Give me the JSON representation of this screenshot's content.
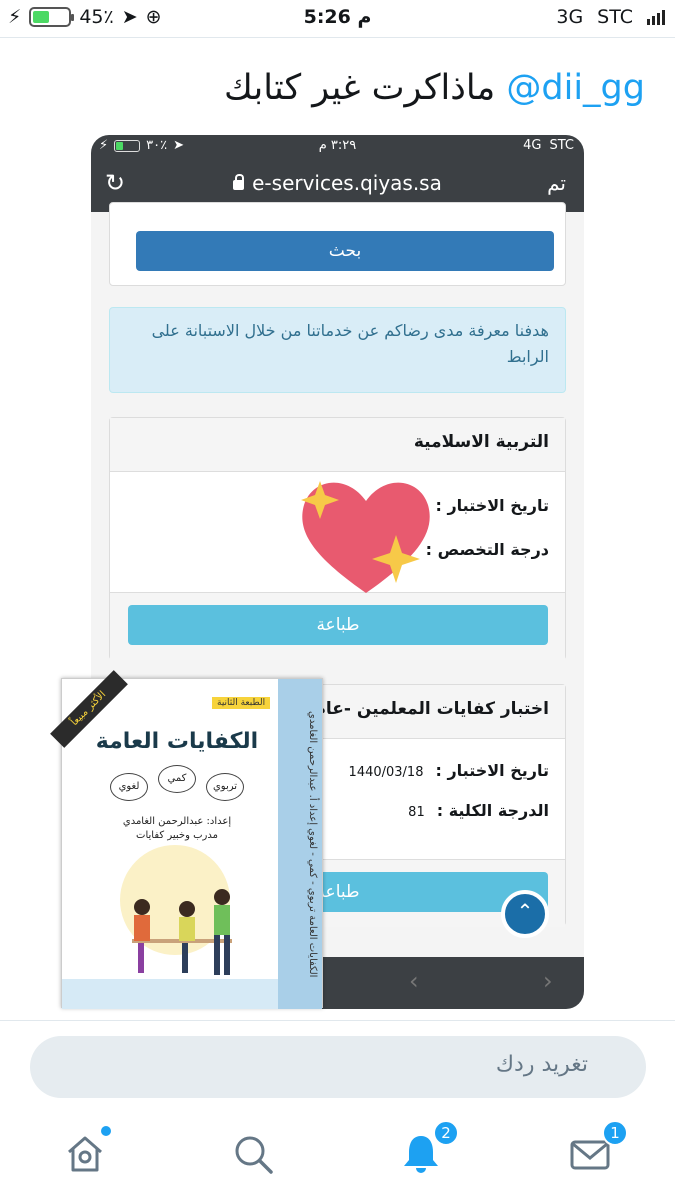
{
  "status_bar": {
    "battery": "45٪",
    "time": "5:26 م",
    "network": "3G",
    "carrier": "STC",
    "battery_level": 0.45
  },
  "tweet": {
    "mention": "@dii_gg",
    "text": "ماذاكرت غير كتابك"
  },
  "embedded": {
    "status": {
      "battery": "٣٠٪",
      "time": "٣:٢٩ م",
      "network": "4G",
      "carrier": "STC"
    },
    "url": "e-services.qiyas.sa",
    "done": "تم",
    "search_button": "بحث",
    "survey_note": "هدفنا معرفة مدى رضاكم عن خدماتنا من خلال الاستبانة على الرابط",
    "card1": {
      "title": "التربية الاسلامية",
      "date_label": "تاريخ الاختبار :",
      "spec_label": "درجة التخصص :",
      "print": "طباعة"
    },
    "card2": {
      "title": "اختبار كفايات المعلمين -عام",
      "date_label": "تاريخ الاختبار :",
      "date_value": "1440/03/18",
      "score_label": "الدرجة الكلية :",
      "score_value": "81",
      "print": "طباعة"
    },
    "scroll_up": "⌃",
    "nav_prev": "‹",
    "nav_next": "›"
  },
  "book": {
    "edition": "الطبعة الثانية",
    "ribbon": "الأكثر مبيعاً",
    "title": "الكفايات العامة",
    "tags": [
      "تربوي",
      "كمي",
      "لغوي"
    ],
    "author_line1": "إعداد: عبدالرحمن الغامدي",
    "author_line2": "مدرب وخبير كفايات",
    "spine": "الكفايات العامة   تربوي - كمي - لغوي   إعداد أ. عبدالرحمن الغامدي"
  },
  "reply_placeholder": "تغريد ردك",
  "tabs": [
    {
      "name": "home",
      "badge": ""
    },
    {
      "name": "search",
      "badge": ""
    },
    {
      "name": "notifications",
      "badge": "2"
    },
    {
      "name": "messages",
      "badge": "1"
    }
  ],
  "colors": {
    "twitter_blue": "#1da1f2",
    "bootstrap_primary": "#337ab7",
    "bootstrap_info": "#5bc0de",
    "heart": "#e85a6f",
    "sparkle": "#f7c948"
  }
}
